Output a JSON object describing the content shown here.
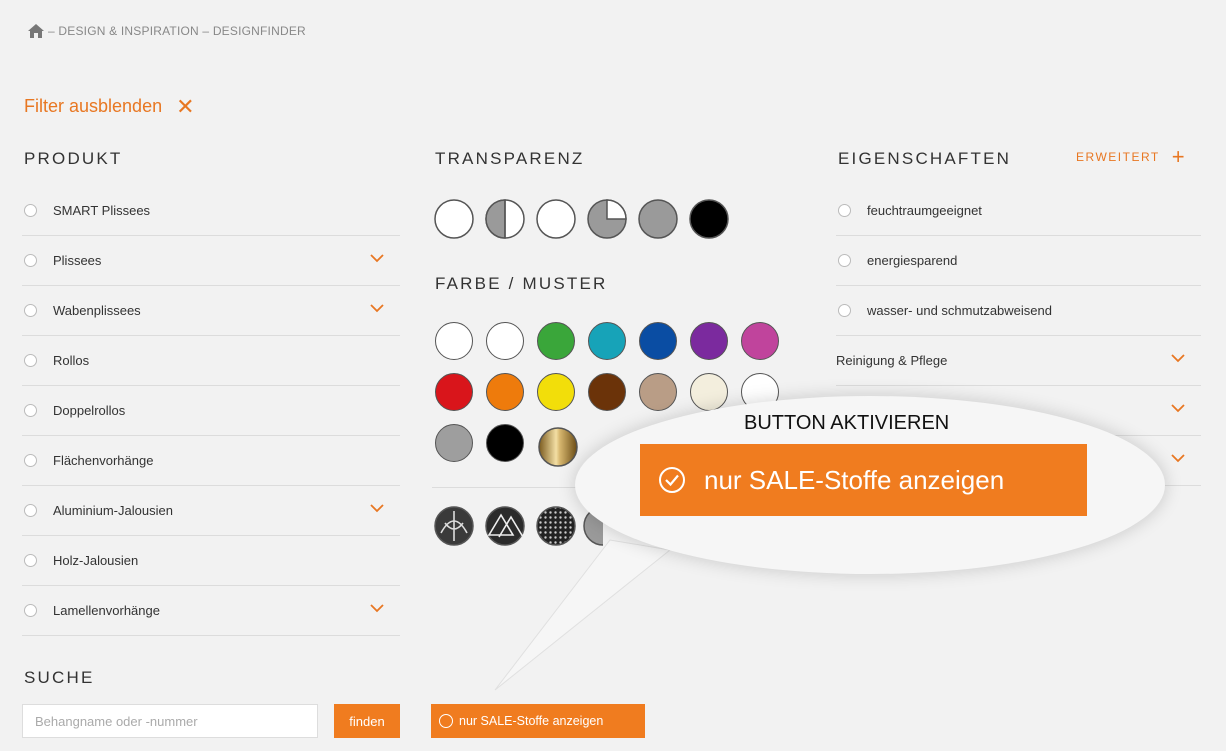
{
  "breadcrumb": {
    "text": "– DESIGN & INSPIRATION – DESIGNFINDER"
  },
  "filter": {
    "label": "Filter ausblenden",
    "close": "✕"
  },
  "produkt": {
    "title": "PRODUKT",
    "items": [
      {
        "label": "SMART Plissees",
        "expand": false
      },
      {
        "label": "Plissees",
        "expand": true
      },
      {
        "label": "Wabenplissees",
        "expand": true
      },
      {
        "label": "Rollos",
        "expand": false
      },
      {
        "label": "Doppelrollos",
        "expand": false
      },
      {
        "label": "Flächenvorhänge",
        "expand": false
      },
      {
        "label": "Aluminium-Jalousien",
        "expand": true
      },
      {
        "label": "Holz-Jalousien",
        "expand": false
      },
      {
        "label": "Lamellenvorhänge",
        "expand": true
      }
    ]
  },
  "transparenz": {
    "title": "TRANSPARENZ"
  },
  "farbe": {
    "title": "FARBE / MUSTER",
    "colors": [
      "#ffffff",
      "#ffffff",
      "#3aa63a",
      "#17a3b8",
      "#0a4da3",
      "#7b2a9e",
      "#c0449c",
      "#d9151b",
      "#ee7b0c",
      "#f2de0a",
      "#6b3309",
      "#b99d86",
      "#f3eedd",
      "#ffffff",
      "#9e9e9e",
      "#000000"
    ]
  },
  "eigenschaften": {
    "title": "EIGENSCHAFTEN",
    "erweitert": "ERWEITERT",
    "items": [
      {
        "label": "feuchtraumgeeignet"
      },
      {
        "label": "energiesparend"
      },
      {
        "label": "wasser- und schmutzabweisend"
      }
    ],
    "groups": [
      {
        "label": "Reinigung & Pflege"
      }
    ]
  },
  "suche": {
    "title": "SUCHE",
    "placeholder": "Behangname oder -nummer",
    "button": "finden"
  },
  "sale": {
    "label": "nur SALE-Stoffe anzeigen"
  },
  "callout": {
    "title": "BUTTON AKTIVIEREN",
    "button": "nur SALE-Stoffe anzeigen"
  },
  "accent": "#f07c1f"
}
